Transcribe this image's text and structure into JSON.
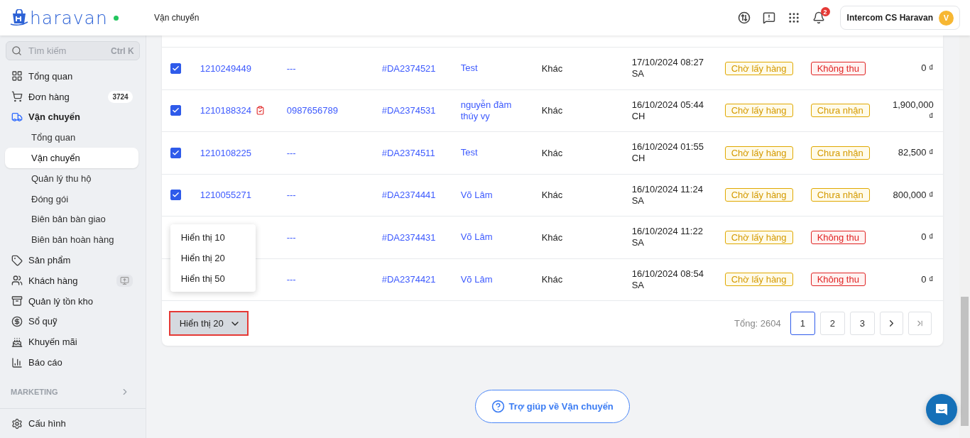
{
  "header": {
    "logo": "haravan",
    "breadcrumb": "Vận chuyển",
    "notification_count": "2",
    "user": {
      "name": "Intercom CS Haravan",
      "avatar": "V"
    }
  },
  "sidebar": {
    "search": {
      "placeholder": "Tìm kiếm",
      "shortcut": "Ctrl K"
    },
    "items": [
      {
        "label": "Tổng quan",
        "active": false
      },
      {
        "label": "Đơn hàng",
        "badge": "3724",
        "active": false
      },
      {
        "label": "Vận chuyển",
        "active": true,
        "expanded": true,
        "children": [
          {
            "label": "Tổng quan",
            "selected": false
          },
          {
            "label": "Vận chuyển",
            "selected": true
          },
          {
            "label": "Quản lý thu hộ",
            "selected": false
          },
          {
            "label": "Đóng gói",
            "selected": false
          },
          {
            "label": "Biên bản bàn giao",
            "selected": false
          },
          {
            "label": "Biên bản hoàn hàng",
            "selected": false
          }
        ]
      },
      {
        "label": "Sản phẩm",
        "active": false
      },
      {
        "label": "Khách hàng",
        "active": false,
        "extra_action": true
      },
      {
        "label": "Quản lý tồn kho",
        "active": false
      },
      {
        "label": "Sổ quỹ",
        "active": false
      },
      {
        "label": "Khuyến mãi",
        "active": false
      },
      {
        "label": "Báo cáo",
        "active": false
      }
    ],
    "section": "MARKETING",
    "footer_item": "Cấu hình"
  },
  "table": {
    "rows": [
      {
        "checked": true,
        "order_id": "1210249449",
        "phone": "---",
        "code": "#DA2374521",
        "customer": "Test",
        "carrier": "Khác",
        "date": "17/10/2024 08:27 SA",
        "status": {
          "label": "Chờ lấy hàng",
          "kind": "pending"
        },
        "payment": {
          "label": "Không thu",
          "kind": "none"
        },
        "amount": "0 ₫"
      },
      {
        "checked": true,
        "order_id": "1210188324",
        "note": true,
        "phone": "0987656789",
        "code": "#DA2374531",
        "customer": "nguyễn đàm thúy vy",
        "carrier": "Khác",
        "date": "16/10/2024 05:44 CH",
        "status": {
          "label": "Chờ lấy hàng",
          "kind": "pending"
        },
        "payment": {
          "label": "Chưa nhận",
          "kind": "pending"
        },
        "amount": "1,900,000 ₫"
      },
      {
        "checked": true,
        "order_id": "1210108225",
        "phone": "---",
        "code": "#DA2374511",
        "customer": "Test",
        "carrier": "Khác",
        "date": "16/10/2024 01:55 CH",
        "status": {
          "label": "Chờ lấy hàng",
          "kind": "pending"
        },
        "payment": {
          "label": "Chưa nhận",
          "kind": "pending"
        },
        "amount": "82,500 ₫"
      },
      {
        "checked": true,
        "order_id": "1210055271",
        "phone": "---",
        "code": "#DA2374441",
        "customer": "Võ Lâm",
        "carrier": "Khác",
        "date": "16/10/2024 11:24 SA",
        "status": {
          "label": "Chờ lấy hàng",
          "kind": "pending"
        },
        "payment": {
          "label": "Chưa nhận",
          "kind": "pending"
        },
        "amount": "800,000 ₫"
      },
      {
        "phone": "---",
        "code": "#DA2374431",
        "customer": "Võ Lâm",
        "carrier": "Khác",
        "date": "16/10/2024 11:22 SA",
        "status": {
          "label": "Chờ lấy hàng",
          "kind": "pending"
        },
        "payment": {
          "label": "Không thu",
          "kind": "none"
        },
        "amount": "0 ₫"
      },
      {
        "phone": "---",
        "code": "#DA2374421",
        "customer": "Võ Lâm",
        "carrier": "Khác",
        "date": "16/10/2024 08:54 SA",
        "status": {
          "label": "Chờ lấy hàng",
          "kind": "pending"
        },
        "payment": {
          "label": "Không thu",
          "kind": "none"
        },
        "amount": "0 ₫"
      }
    ],
    "page_size": {
      "label": "Hiển thị 20",
      "expanded": true,
      "options": [
        "Hiển thị 10",
        "Hiển thị 20",
        "Hiển thị 50"
      ]
    },
    "total": "Tổng: 2604",
    "pages": [
      {
        "label": "1",
        "selected": true
      },
      {
        "label": "2",
        "selected": false
      },
      {
        "label": "3",
        "selected": false
      }
    ]
  },
  "help_button": "Trợ giúp về Vận chuyển"
}
